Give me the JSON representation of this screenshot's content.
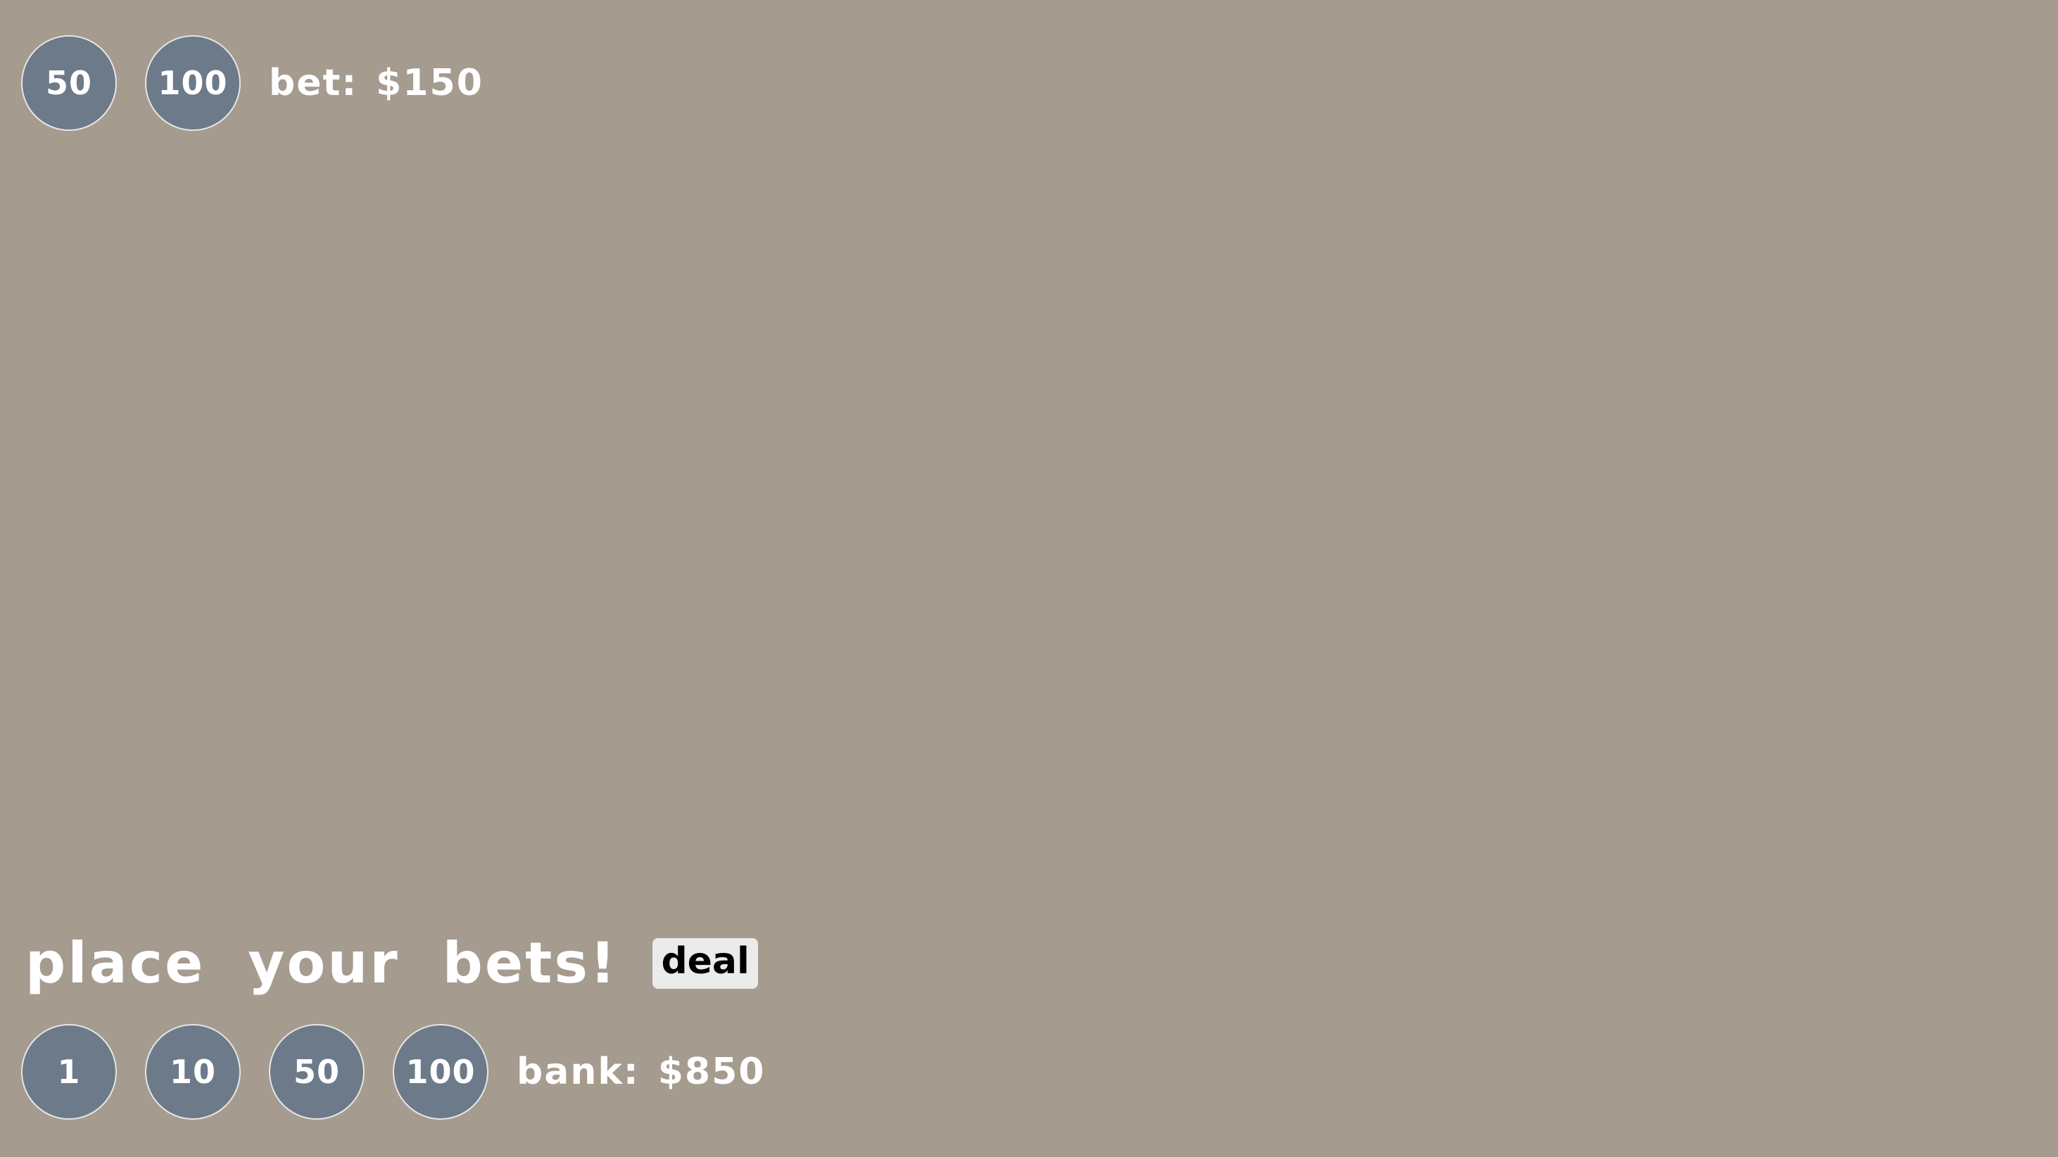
{
  "theme": {
    "table_color": "#a59b8e",
    "chip_color": "#6c7a8a",
    "text_color": "#ffffff",
    "button_bg": "#ebebeb"
  },
  "bet_area": {
    "chips": [
      {
        "label": "50"
      },
      {
        "label": "100"
      }
    ],
    "bet_label": "bet:",
    "bet_value": "$150"
  },
  "prompt": {
    "text": "place your bets!",
    "deal_label": "deal"
  },
  "bank_area": {
    "chips": [
      {
        "label": "1"
      },
      {
        "label": "10"
      },
      {
        "label": "50"
      },
      {
        "label": "100"
      }
    ],
    "bank_label": "bank:",
    "bank_value": "$850"
  }
}
